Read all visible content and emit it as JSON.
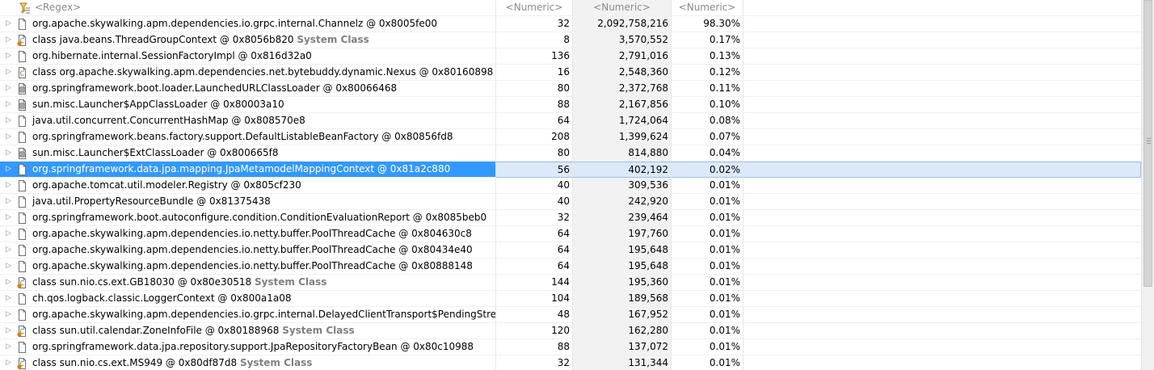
{
  "header": {
    "name_filter": "<Regex>",
    "objects_filter": "<Numeric>",
    "shallow_filter": "<Numeric>",
    "retained_filter": "<Numeric>"
  },
  "rows": [
    {
      "name": "org.apache.skywalking.apm.dependencies.io.grpc.internal.Channelz @ 0x8005fe00",
      "suffix": "",
      "objects": "32",
      "shallow": "2,092,758,216",
      "retained": "98.30%",
      "icon": "object-icon",
      "selected": false
    },
    {
      "name": "class java.beans.ThreadGroupContext @ 0x8056b820",
      "suffix": "System Class",
      "objects": "8",
      "shallow": "3,570,552",
      "retained": "0.17%",
      "icon": "class-gc-root-icon",
      "selected": false
    },
    {
      "name": "org.hibernate.internal.SessionFactoryImpl @ 0x816d32a0",
      "suffix": "",
      "objects": "136",
      "shallow": "2,791,016",
      "retained": "0.13%",
      "icon": "object-icon",
      "selected": false
    },
    {
      "name": "class org.apache.skywalking.apm.dependencies.net.bytebuddy.dynamic.Nexus @ 0x80160898",
      "suffix": "",
      "objects": "16",
      "shallow": "2,548,360",
      "retained": "0.12%",
      "icon": "class-icon",
      "selected": false
    },
    {
      "name": "org.springframework.boot.loader.LaunchedURLClassLoader @ 0x80066468",
      "suffix": "",
      "objects": "80",
      "shallow": "2,372,768",
      "retained": "0.11%",
      "icon": "classloader-icon",
      "selected": false
    },
    {
      "name": "sun.misc.Launcher$AppClassLoader @ 0x80003a10",
      "suffix": "",
      "objects": "88",
      "shallow": "2,167,856",
      "retained": "0.10%",
      "icon": "classloader-icon",
      "selected": false
    },
    {
      "name": "java.util.concurrent.ConcurrentHashMap @ 0x808570e8",
      "suffix": "",
      "objects": "64",
      "shallow": "1,724,064",
      "retained": "0.08%",
      "icon": "object-icon",
      "selected": false
    },
    {
      "name": "org.springframework.beans.factory.support.DefaultListableBeanFactory @ 0x80856fd8",
      "suffix": "",
      "objects": "208",
      "shallow": "1,399,624",
      "retained": "0.07%",
      "icon": "object-icon",
      "selected": false
    },
    {
      "name": "sun.misc.Launcher$ExtClassLoader @ 0x800665f8",
      "suffix": "",
      "objects": "80",
      "shallow": "814,880",
      "retained": "0.04%",
      "icon": "classloader-icon",
      "selected": false
    },
    {
      "name": "org.springframework.data.jpa.mapping.JpaMetamodelMappingContext @ 0x81a2c880",
      "suffix": "",
      "objects": "56",
      "shallow": "402,192",
      "retained": "0.02%",
      "icon": "object-icon",
      "selected": true
    },
    {
      "name": "org.apache.tomcat.util.modeler.Registry @ 0x805cf230",
      "suffix": "",
      "objects": "40",
      "shallow": "309,536",
      "retained": "0.01%",
      "icon": "object-icon",
      "selected": false
    },
    {
      "name": "java.util.PropertyResourceBundle @ 0x81375438",
      "suffix": "",
      "objects": "40",
      "shallow": "242,920",
      "retained": "0.01%",
      "icon": "object-icon",
      "selected": false
    },
    {
      "name": "org.springframework.boot.autoconfigure.condition.ConditionEvaluationReport @ 0x8085beb0",
      "suffix": "",
      "objects": "32",
      "shallow": "239,464",
      "retained": "0.01%",
      "icon": "object-icon",
      "selected": false
    },
    {
      "name": "org.apache.skywalking.apm.dependencies.io.netty.buffer.PoolThreadCache @ 0x804630c8",
      "suffix": "",
      "objects": "64",
      "shallow": "197,760",
      "retained": "0.01%",
      "icon": "object-icon",
      "selected": false
    },
    {
      "name": "org.apache.skywalking.apm.dependencies.io.netty.buffer.PoolThreadCache @ 0x80434e40",
      "suffix": "",
      "objects": "64",
      "shallow": "195,648",
      "retained": "0.01%",
      "icon": "object-icon",
      "selected": false
    },
    {
      "name": "org.apache.skywalking.apm.dependencies.io.netty.buffer.PoolThreadCache @ 0x80888148",
      "suffix": "",
      "objects": "64",
      "shallow": "195,648",
      "retained": "0.01%",
      "icon": "object-icon",
      "selected": false
    },
    {
      "name": "class sun.nio.cs.ext.GB18030 @ 0x80e30518",
      "suffix": "System Class",
      "objects": "144",
      "shallow": "195,360",
      "retained": "0.01%",
      "icon": "class-gc-root-icon",
      "selected": false
    },
    {
      "name": "ch.qos.logback.classic.LoggerContext @ 0x800a1a08",
      "suffix": "",
      "objects": "104",
      "shallow": "189,568",
      "retained": "0.01%",
      "icon": "object-icon",
      "selected": false
    },
    {
      "name": "org.apache.skywalking.apm.dependencies.io.grpc.internal.DelayedClientTransport$PendingStream",
      "suffix": "",
      "objects": "48",
      "shallow": "167,952",
      "retained": "0.01%",
      "icon": "object-icon",
      "selected": false
    },
    {
      "name": "class sun.util.calendar.ZoneInfoFile @ 0x80188968",
      "suffix": "System Class",
      "objects": "120",
      "shallow": "162,280",
      "retained": "0.01%",
      "icon": "class-gc-root-icon",
      "selected": false
    },
    {
      "name": "org.springframework.data.jpa.repository.support.JpaRepositoryFactoryBean @ 0x80c10988",
      "suffix": "",
      "objects": "88",
      "shallow": "137,072",
      "retained": "0.01%",
      "icon": "object-icon",
      "selected": false
    },
    {
      "name": "class sun.nio.cs.ext.MS949 @ 0x80df87d8",
      "suffix": "System Class",
      "objects": "32",
      "shallow": "131,344",
      "retained": "0.01%",
      "icon": "class-gc-root-icon",
      "selected": false
    }
  ],
  "colors": {
    "selection": "#3399ff",
    "selection_light": "#dbe9fa",
    "system_class_text": "#808080",
    "header_text": "#8a8a8a",
    "shallow_column_bg": "#f2f2f2",
    "class_icon_orange": "#e07b00",
    "class_icon_green": "#3c8c3c"
  }
}
